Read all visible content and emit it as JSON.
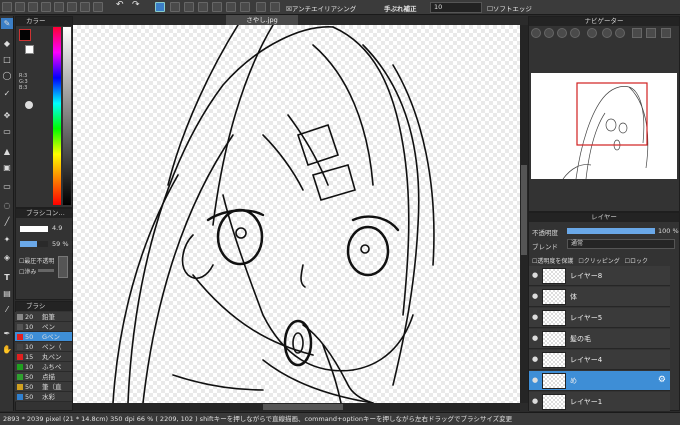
{
  "toolbar": {
    "antialias_label": "アンチエイリアシング",
    "stabilizer_label": "手ぶれ補正",
    "stabilizer_value": "10",
    "soft_edge_label": "ソフトエッジ"
  },
  "document": {
    "tab_title": "さやし.jpg"
  },
  "color_panel": {
    "title": "カラー",
    "r": "R:3",
    "g": "G:3",
    "b": "B:3"
  },
  "brush_control": {
    "title": "ブラシコン…",
    "size_value": "4.9",
    "opacity_value": "59 %",
    "pressure_label": "最圧不透明",
    "blur_label": "滲み"
  },
  "brush_list": {
    "title": "ブラシ",
    "items": [
      {
        "size": "20",
        "name": "鉛筆",
        "color": "#888888"
      },
      {
        "size": "10",
        "name": "ペン",
        "color": "#555555"
      },
      {
        "size": "50",
        "name": "Gペン",
        "color": "#e02020"
      },
      {
        "size": "10",
        "name": "ペン（",
        "color": "#444444"
      },
      {
        "size": "15",
        "name": "丸ペン",
        "color": "#e02020"
      },
      {
        "size": "10",
        "name": "ふちペ",
        "color": "#20a020"
      },
      {
        "size": "50",
        "name": "点描",
        "color": "#30a030"
      },
      {
        "size": "50",
        "name": "筆（直",
        "color": "#d0a020"
      },
      {
        "size": "50",
        "name": "水彩",
        "color": "#3080d0"
      }
    ]
  },
  "navigator": {
    "title": "ナビゲーター"
  },
  "layers": {
    "title": "レイヤー",
    "opacity_label": "不透明度",
    "opacity_value": "100 %",
    "blend_label": "ブレンド",
    "blend_value": "通常",
    "protect_label": "透明度を保護",
    "clip_label": "クリッピング",
    "lock_label": "ロック",
    "items": [
      {
        "name": "レイヤー8"
      },
      {
        "name": "体"
      },
      {
        "name": "レイヤー5"
      },
      {
        "name": "髪の毛"
      },
      {
        "name": "レイヤー4"
      },
      {
        "name": "め"
      },
      {
        "name": "レイヤー1"
      }
    ],
    "selected_index": 5
  },
  "status": {
    "text": "2893 * 2039 pixel (21 * 14.8cm)  350 dpi   66 %   ( 2209, 102 )   shiftキーを押しながらで直線描画、command+optionキーを押しながら左右ドラッグでブラシサイズ変更"
  },
  "colors": {
    "accent": "#3e8ed6",
    "fg_color": "#030303",
    "bg_color": "#ffffff"
  }
}
